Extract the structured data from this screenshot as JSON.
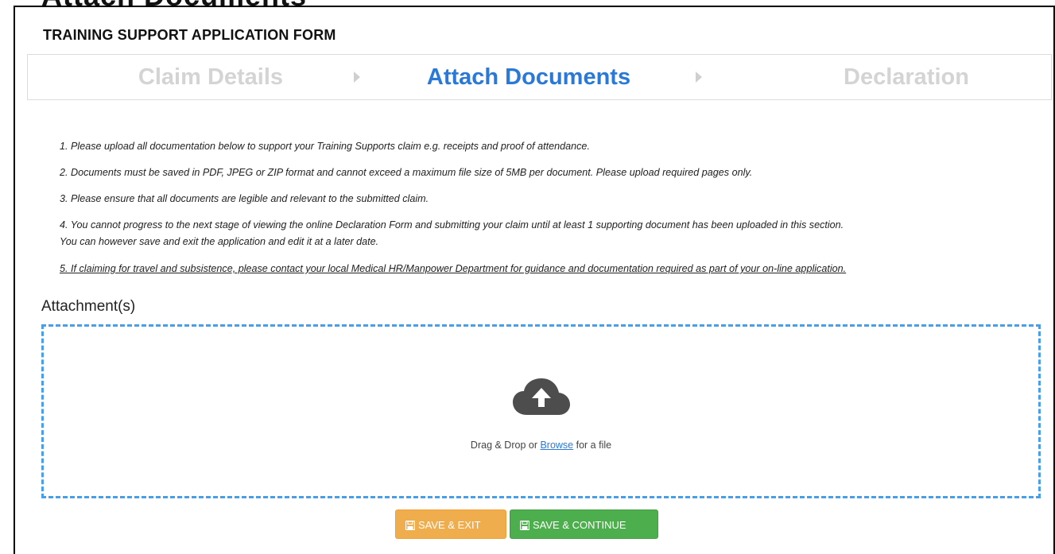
{
  "page": {
    "cut_heading": "Attach Documents"
  },
  "form": {
    "title": "TRAINING SUPPORT APPLICATION FORM"
  },
  "steps": [
    {
      "label": "Claim Details",
      "state": "inactive"
    },
    {
      "label": "Attach Documents",
      "state": "active"
    },
    {
      "label": "Declaration",
      "state": "inactive"
    }
  ],
  "instructions": [
    "1. Please upload all documentation below to support your Training Supports claim e.g. receipts and proof of attendance.",
    "2. Documents must be saved in PDF, JPEG or ZIP format and cannot exceed a maximum file size of 5MB per document. Please upload required pages only.",
    "3. Please ensure that all documents are legible and relevant to the submitted claim.",
    "4. You cannot progress to the next stage of viewing the online Declaration Form and submitting your claim until at least 1 supporting document has been uploaded in this section.",
    "You can however save and exit the application and edit it at a later date.",
    "5. If claiming for travel and subsistence, please contact your local Medical HR/Manpower Department for guidance and documentation required as part of your on-line application."
  ],
  "attachments": {
    "label": "Attachment(s)",
    "dropzone_text_before": "Drag & Drop or ",
    "browse_link": "Browse",
    "dropzone_text_after": " for a file",
    "icon": "cloud-upload-icon"
  },
  "buttons": {
    "save_exit": "SAVE & EXIT",
    "save_continue": "SAVE & CONTINUE",
    "icon": "floppy-disk-icon"
  },
  "colors": {
    "active_step": "#2a79d6",
    "inactive_step": "#d4d4d4",
    "dropzone_border": "#4a9ee6",
    "save_exit_bg": "#f0ad4e",
    "save_continue_bg": "#4cae4c"
  }
}
